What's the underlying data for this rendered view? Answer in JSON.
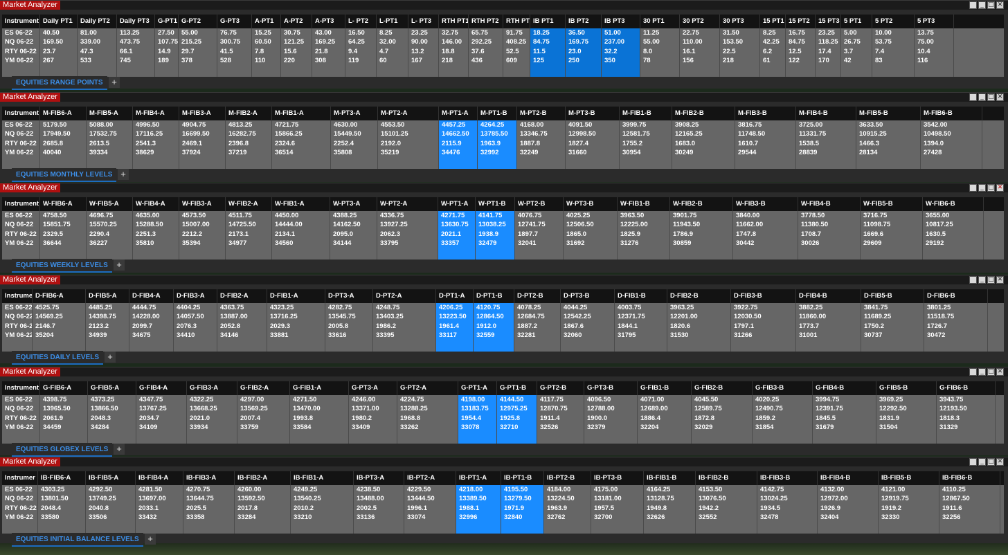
{
  "app_title": "Market Analyzer",
  "instruments": [
    "ES 06-22",
    "NQ 06-22",
    "RTY 06-22",
    "YM 06-22"
  ],
  "windows": [
    {
      "tab": "EQUITIES RANGE POINTS",
      "instrument_header": "Instrument",
      "columns": [
        "Daily PT1",
        "Daily PT2",
        "Daily PT3",
        "G-PT1",
        "G-PT2",
        "G-PT3",
        "A-PT1",
        "A-PT2",
        "A-PT3",
        "L- PT2",
        "L-PT1",
        "L- PT3",
        "RTH PT1",
        "RTH PT2",
        "RTH PT",
        "IB PT1",
        "IB PT2",
        "IB PT3",
        "30 PT1",
        "30 PT2",
        "30 PT3",
        "15 PT1",
        "15 PT2",
        "15 PT3",
        "5 PT1",
        "5 PT2",
        "5 PT3"
      ],
      "widths": [
        54,
        57,
        55,
        34,
        56,
        50,
        42,
        45,
        48,
        45,
        46,
        44,
        43,
        50,
        39,
        51,
        52,
        56,
        57,
        58,
        58,
        37,
        43,
        37,
        45,
        61,
        57
      ],
      "highlight": [
        15,
        16,
        17
      ],
      "rows": [
        [
          "40.50",
          "81.00",
          "113.25",
          "27.50",
          "55.00",
          "76.75",
          "15.25",
          "30.75",
          "43.00",
          "16.50",
          "8.25",
          "23.25",
          "32.75",
          "65.75",
          "91.75",
          "18.25",
          "36.50",
          "51.00",
          "11.25",
          "22.75",
          "31.50",
          "8.25",
          "16.75",
          "23.25",
          "5.00",
          "10.00",
          "13.75"
        ],
        [
          "169.50",
          "339.00",
          "473.75",
          "107.75",
          "215.25",
          "300.75",
          "60.50",
          "121.25",
          "169.25",
          "64.25",
          "32.00",
          "90.00",
          "146.00",
          "292.25",
          "408.25",
          "84.75",
          "169.75",
          "237.00",
          "55.00",
          "110.00",
          "153.50",
          "42.25",
          "84.75",
          "118.25",
          "26.75",
          "53.75",
          "75.00"
        ],
        [
          "23.7",
          "47.3",
          "66.1",
          "14.9",
          "29.7",
          "41.5",
          "7.8",
          "15.6",
          "21.8",
          "9.4",
          "4.7",
          "13.2",
          "18.8",
          "37.6",
          "52.5",
          "11.5",
          "23.0",
          "32.2",
          "8.0",
          "16.1",
          "22.5",
          "6.2",
          "12.5",
          "17.4",
          "3.7",
          "7.4",
          "10.4"
        ],
        [
          "267",
          "533",
          "745",
          "189",
          "378",
          "528",
          "110",
          "220",
          "308",
          "119",
          "60",
          "167",
          "218",
          "436",
          "609",
          "125",
          "250",
          "350",
          "78",
          "156",
          "218",
          "61",
          "122",
          "170",
          "42",
          "83",
          "116"
        ]
      ]
    },
    {
      "tab": "EQUITIES MONTHLY LEVELS",
      "instrument_header": "Instrument",
      "columns": [
        "M-FIB6-A",
        "M-FIB5-A",
        "M-FIB4-A",
        "M-FIB3-A",
        "M-FIB2-A",
        "M-FIB1-A",
        "M-PT3-A",
        "M-PT2-A",
        "M-PT1-A",
        "M-PT1-B",
        "M-PT2-B",
        "M-PT3-B",
        "M-FIB1-B",
        "M-FIB2-B",
        "M-FIB3-B",
        "M-FIB4-B",
        "M-FIB5-B",
        "M-FIB6-B"
      ],
      "widths": [
        67,
        67,
        67,
        67,
        67,
        85,
        68,
        88,
        56,
        57,
        70,
        78,
        76,
        91,
        88,
        87,
        93,
        89
      ],
      "highlight": [
        8,
        9
      ],
      "rows": [
        [
          "5179.50",
          "5088.00",
          "4996.50",
          "4904.75",
          "4813.25",
          "4721.75",
          "4630.00",
          "4553.50",
          "4457.25",
          "4264.25",
          "4168.00",
          "4091.50",
          "3999.75",
          "3908.25",
          "3816.75",
          "3725.00",
          "3633.50",
          "3542.00"
        ],
        [
          "17949.50",
          "17532.75",
          "17116.25",
          "16699.50",
          "16282.75",
          "15866.25",
          "15449.50",
          "15101.25",
          "14662.50",
          "13785.50",
          "13346.75",
          "12998.50",
          "12581.75",
          "12165.25",
          "11748.50",
          "11331.75",
          "10915.25",
          "10498.50"
        ],
        [
          "2685.8",
          "2613.5",
          "2541.3",
          "2469.1",
          "2396.8",
          "2324.6",
          "2252.4",
          "2192.0",
          "2115.9",
          "1963.9",
          "1887.8",
          "1827.4",
          "1755.2",
          "1683.0",
          "1610.7",
          "1538.5",
          "1466.3",
          "1394.0"
        ],
        [
          "40040",
          "39334",
          "38629",
          "37924",
          "37219",
          "36514",
          "35808",
          "35219",
          "34476",
          "32992",
          "32249",
          "31660",
          "30954",
          "30249",
          "29544",
          "28839",
          "28134",
          "27428"
        ]
      ]
    },
    {
      "tab": "EQUITIES WEEKLY LEVELS",
      "instrument_header": "Instrument",
      "columns": [
        "W-FIB6-A",
        "W-FIB5-A",
        "W-FIB4-A",
        "W-FIB3-A",
        "W-FIB2-A",
        "W-FIB1-A",
        "W-PT3-A",
        "W-PT2-A",
        "W-PT1-A",
        "W-PT1-B",
        "W-PT2-B",
        "W-PT3-B",
        "W-FIB1-B",
        "W-FIB2-B",
        "W-FIB3-B",
        "W-FIB4-B",
        "W-FIB5-B",
        "W-FIB6-B"
      ],
      "widths": [
        67,
        67,
        67,
        67,
        67,
        84,
        68,
        88,
        54,
        57,
        70,
        78,
        76,
        91,
        94,
        90,
        90,
        88
      ],
      "highlight": [
        8,
        9
      ],
      "rows": [
        [
          "4758.50",
          "4696.75",
          "4635.00",
          "4573.50",
          "4511.75",
          "4450.00",
          "4388.25",
          "4336.75",
          "4271.75",
          "4141.75",
          "4076.75",
          "4025.25",
          "3963.50",
          "3901.75",
          "3840.00",
          "3778.50",
          "3716.75",
          "3655.00"
        ],
        [
          "15851.75",
          "15570.25",
          "15288.50",
          "15007.00",
          "14725.50",
          "14444.00",
          "14162.50",
          "13927.25",
          "13630.75",
          "13038.25",
          "12741.75",
          "12506.50",
          "12225.00",
          "11943.50",
          "11662.00",
          "11380.50",
          "11098.75",
          "10817.25"
        ],
        [
          "2329.5",
          "2290.4",
          "2251.3",
          "2212.2",
          "2173.1",
          "2134.1",
          "2095.0",
          "2062.3",
          "2021.1",
          "1938.9",
          "1897.7",
          "1865.0",
          "1825.9",
          "1786.9",
          "1747.8",
          "1708.7",
          "1669.6",
          "1630.5"
        ],
        [
          "36644",
          "36227",
          "35810",
          "35394",
          "34977",
          "34560",
          "34144",
          "33795",
          "33357",
          "32479",
          "32041",
          "31692",
          "31276",
          "30859",
          "30442",
          "30026",
          "29609",
          "29192"
        ]
      ]
    },
    {
      "tab": "EQUITIES DAILY LEVELS",
      "instrument_header": "Instrument",
      "columns": [
        "D-FIB6-A",
        "D-FIB5-A",
        "D-FIB4-A",
        "D-FIB3-A",
        "D-FIB2-A",
        "D-FIB1-A",
        "D-PT3-A",
        "D-PT2-A",
        "D-PT1-A",
        "D-PT1-B",
        "D-PT2-B",
        "D-PT3-B",
        "D-FIB1-B",
        "D-FIB2-B",
        "D-FIB3-B",
        "D-FIB4-B",
        "D-FIB5-B",
        "D-FIB6-B"
      ],
      "widths": [
        77,
        63,
        64,
        63,
        72,
        84,
        69,
        91,
        54,
        59,
        67,
        78,
        76,
        92,
        94,
        94,
        91,
        92
      ],
      "highlight": [
        8,
        9
      ],
      "rows": [
        [
          "4525.75",
          "4485.25",
          "4444.75",
          "4404.25",
          "4363.75",
          "4323.25",
          "4282.75",
          "4248.75",
          "4206.25",
          "4120.75",
          "4078.25",
          "4044.25",
          "4003.75",
          "3963.25",
          "3922.75",
          "3882.25",
          "3841.75",
          "3801.25"
        ],
        [
          "14569.25",
          "14398.75",
          "14228.00",
          "14057.50",
          "13887.00",
          "13716.25",
          "13545.75",
          "13403.25",
          "13223.50",
          "12864.50",
          "12684.75",
          "12542.25",
          "12371.75",
          "12201.00",
          "12030.50",
          "11860.00",
          "11689.25",
          "11518.75"
        ],
        [
          "2146.7",
          "2123.2",
          "2099.7",
          "2076.3",
          "2052.8",
          "2029.3",
          "2005.8",
          "1986.2",
          "1961.4",
          "1912.0",
          "1887.2",
          "1867.6",
          "1844.1",
          "1820.6",
          "1797.1",
          "1773.7",
          "1750.2",
          "1726.7"
        ],
        [
          "35204",
          "34939",
          "34675",
          "34410",
          "34146",
          "33881",
          "33616",
          "33395",
          "33117",
          "32559",
          "32281",
          "32060",
          "31795",
          "31530",
          "31266",
          "31001",
          "30737",
          "30472"
        ]
      ]
    },
    {
      "tab": "EQUITIES GLOBEX LEVELS",
      "instrument_header": "Instrument",
      "columns": [
        "G-FIB6-A",
        "G-FIB5-A",
        "G-FIB4-A",
        "G-FIB3-A",
        "G-FIB2-A",
        "G-FIB1-A",
        "G-PT3-A",
        "G-PT2-A",
        "G-PT1-A",
        "G-PT1-B",
        "G-PT2-B",
        "G-PT3-B",
        "G-FIB1-B",
        "G-FIB2-B",
        "G-FIB3-B",
        "G-FIB4-B",
        "G-FIB5-B",
        "G-FIB6-B"
      ],
      "widths": [
        69,
        70,
        73,
        73,
        76,
        85,
        70,
        88,
        56,
        58,
        68,
        77,
        78,
        88,
        87,
        92,
        87,
        85
      ],
      "highlight": [
        8,
        9
      ],
      "rows": [
        [
          "4398.75",
          "4373.25",
          "4347.75",
          "4322.25",
          "4297.00",
          "4271.50",
          "4246.00",
          "4224.75",
          "4198.00",
          "4144.50",
          "4117.75",
          "4096.50",
          "4071.00",
          "4045.50",
          "4020.25",
          "3994.75",
          "3969.25",
          "3943.75"
        ],
        [
          "13965.50",
          "13866.50",
          "13767.25",
          "13668.25",
          "13569.25",
          "13470.00",
          "13371.00",
          "13288.25",
          "13183.75",
          "12975.25",
          "12870.75",
          "12788.00",
          "12689.00",
          "12589.75",
          "12490.75",
          "12391.75",
          "12292.50",
          "12193.50"
        ],
        [
          "2061.9",
          "2048.3",
          "2034.7",
          "2021.0",
          "2007.4",
          "1993.8",
          "1980.2",
          "1968.8",
          "1954.4",
          "1925.8",
          "1911.4",
          "1900.0",
          "1886.4",
          "1872.8",
          "1859.2",
          "1845.5",
          "1831.9",
          "1818.3"
        ],
        [
          "34459",
          "34284",
          "34109",
          "33934",
          "33759",
          "33584",
          "33409",
          "33262",
          "33078",
          "32710",
          "32526",
          "32379",
          "32204",
          "32029",
          "31854",
          "31679",
          "31504",
          "31329"
        ]
      ]
    },
    {
      "tab": "EQUITIES INITIAL BALANCE LEVELS",
      "instrument_header": "Instrumer",
      "columns": [
        "IB-FIB6-A",
        "IB-FIB5-A",
        "IB-FIB4-A",
        "IB-FIB3-A",
        "IB-FIB2-A",
        "IB-FIB1-A",
        "IB-PT3-A",
        "IB-PT2-A",
        "IB-PT1-A",
        "IB-PT1-B",
        "IB-PT2-B",
        "IB-PT3-B",
        "IB-FIB1-B",
        "IB-FIB2-B",
        "IB-FIB3-B",
        "IB-FIB4-B",
        "IB-FIB5-B",
        "IB-FIB6-B"
      ],
      "widths": [
        69,
        72,
        69,
        74,
        81,
        91,
        73,
        75,
        65,
        62,
        68,
        76,
        75,
        89,
        87,
        88,
        88,
        88
      ],
      "highlight": [
        8,
        9
      ],
      "rows": [
        [
          "4303.25",
          "4292.50",
          "4281.50",
          "4270.75",
          "4260.00",
          "4249.25",
          "4238.50",
          "4229.50",
          "4218.00",
          "4195.50",
          "4184.00",
          "4175.00",
          "4164.25",
          "4153.50",
          "4142.75",
          "4132.00",
          "4121.00",
          "4110.25"
        ],
        [
          "13801.50",
          "13749.25",
          "13697.00",
          "13644.75",
          "13592.50",
          "13540.25",
          "13488.00",
          "13444.50",
          "13389.50",
          "13279.50",
          "13224.50",
          "13181.00",
          "13128.75",
          "13076.50",
          "13024.25",
          "12972.00",
          "12919.75",
          "12867.50"
        ],
        [
          "2048.4",
          "2040.8",
          "2033.1",
          "2025.5",
          "2017.8",
          "2010.2",
          "2002.5",
          "1996.1",
          "1988.1",
          "1971.9",
          "1963.9",
          "1957.5",
          "1949.8",
          "1942.2",
          "1934.5",
          "1926.9",
          "1919.2",
          "1911.6"
        ],
        [
          "33580",
          "33506",
          "33432",
          "33358",
          "33284",
          "33210",
          "33136",
          "33074",
          "32996",
          "32840",
          "32762",
          "32700",
          "32626",
          "32552",
          "32478",
          "32404",
          "32330",
          "32256"
        ]
      ]
    }
  ]
}
